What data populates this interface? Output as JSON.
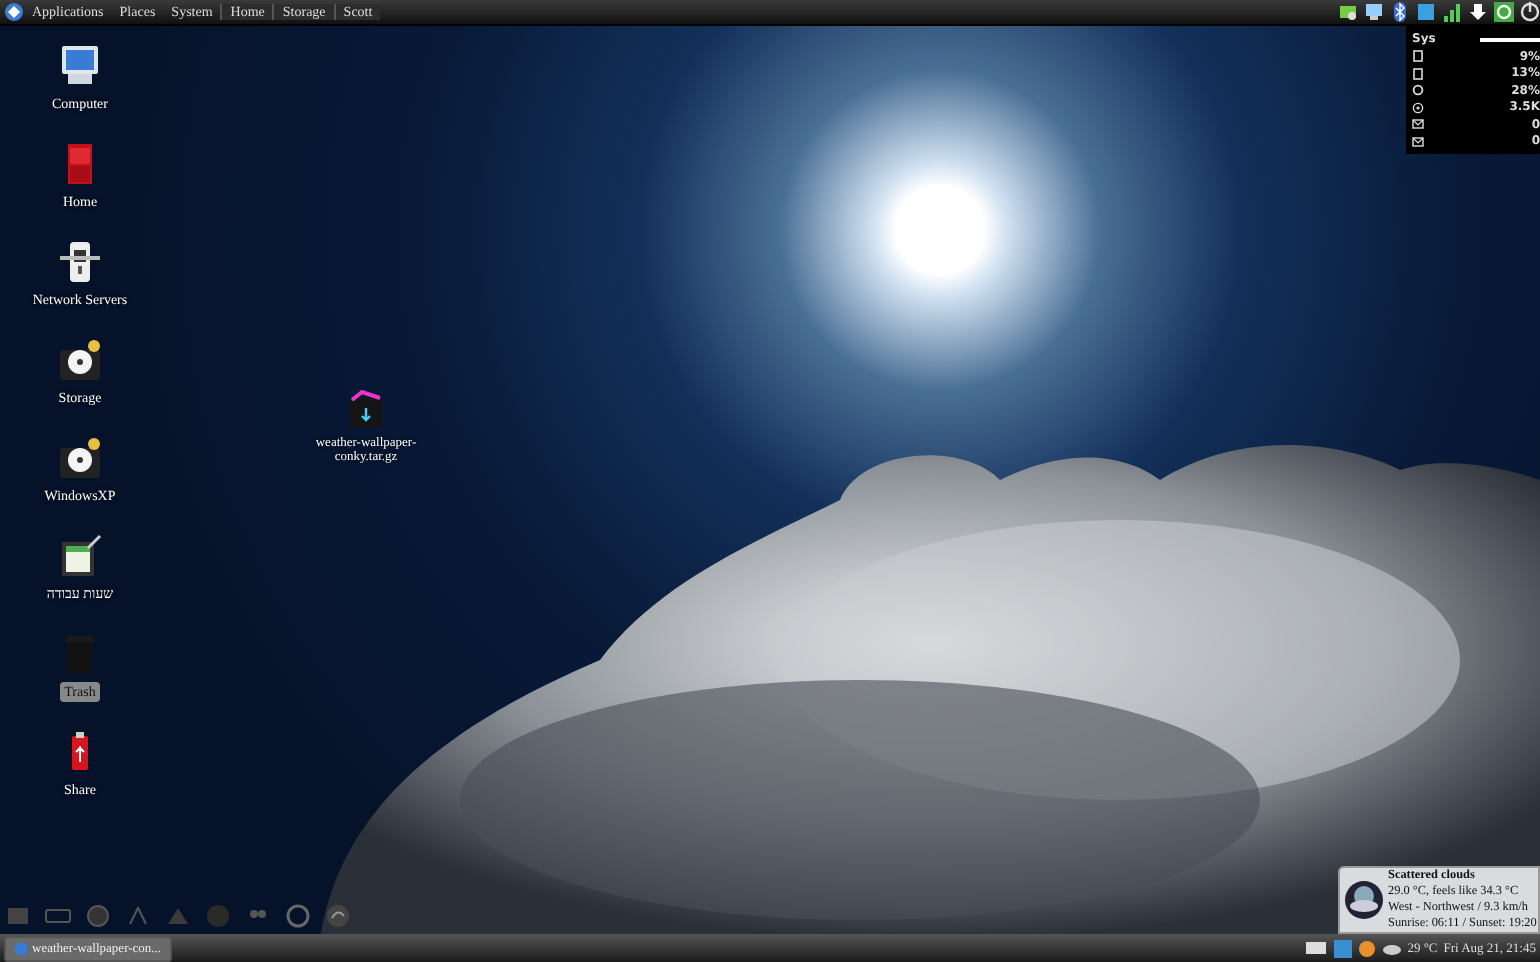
{
  "top_panel": {
    "menus": [
      {
        "label": "Applications"
      },
      {
        "label": "Places"
      },
      {
        "label": "System"
      },
      {
        "label": "Home"
      },
      {
        "label": "Storage"
      },
      {
        "label": "Scott"
      }
    ]
  },
  "conky": {
    "title": "Sys",
    "rows": [
      {
        "kind": "page",
        "value": "9%"
      },
      {
        "kind": "page",
        "value": "13%"
      },
      {
        "kind": "ring",
        "value": "28%"
      },
      {
        "kind": "target",
        "value": "3.5K"
      },
      {
        "kind": "envelope",
        "value": "0"
      },
      {
        "kind": "envelope",
        "value": "0"
      }
    ]
  },
  "desktop_icons": [
    {
      "kind": "computer",
      "label": "Computer",
      "selected": false
    },
    {
      "kind": "home",
      "label": "Home",
      "selected": false
    },
    {
      "kind": "server",
      "label": "Network Servers",
      "selected": false
    },
    {
      "kind": "drive",
      "label": "Storage",
      "selected": false
    },
    {
      "kind": "drive",
      "label": "WindowsXP",
      "selected": false
    },
    {
      "kind": "sheet",
      "label": "שעות עבודה",
      "selected": false
    },
    {
      "kind": "trash",
      "label": "Trash",
      "selected": true
    },
    {
      "kind": "usb",
      "label": "Share",
      "selected": false
    }
  ],
  "desktop_files": [
    {
      "label": "weather-wallpaper-conky.tar.gz"
    }
  ],
  "weather": {
    "condition": "Scattered clouds",
    "temperature": "29.0 °C, feels like 34.3 °C",
    "wind": "West - Northwest / 9.3 km/h",
    "sun": "Sunrise: 06:11 / Sunset: 19:20"
  },
  "taskbar": {
    "tasks": [
      {
        "label": "weather-wallpaper-con...",
        "selected": true
      }
    ],
    "temperature": "29 °C",
    "clock": "Fri Aug 21, 21:45"
  }
}
